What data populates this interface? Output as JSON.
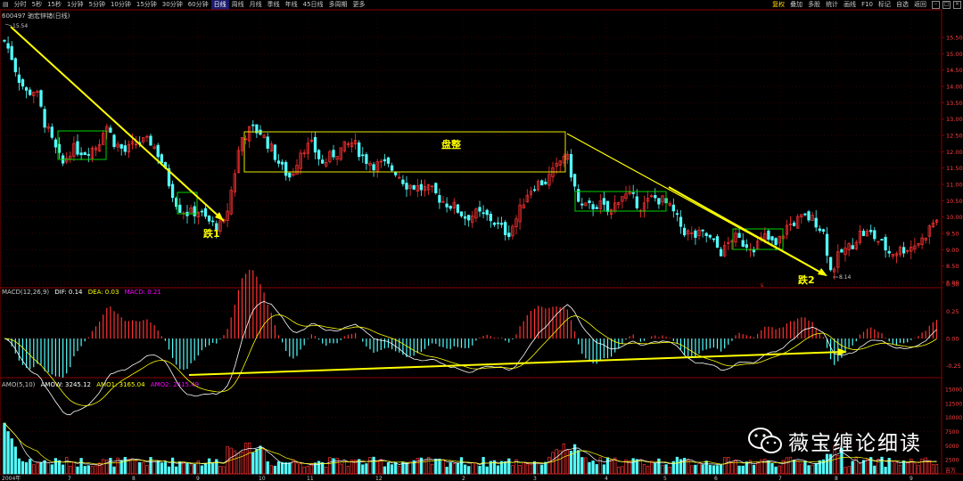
{
  "toolbar": {
    "items": [
      "分时",
      "5秒",
      "15秒",
      "1分钟",
      "5分钟",
      "10分钟",
      "15分钟",
      "30分钟",
      "60分钟",
      "日线",
      "周线",
      "月线",
      "季线",
      "年线",
      "45日线",
      "多周期",
      "更多"
    ],
    "active_index": 9,
    "right_items": [
      "复权",
      "叠加",
      "多股",
      "统计",
      "画线",
      "F10",
      "标记",
      "自选",
      "返回"
    ],
    "right_highlight_index": 0
  },
  "stock": {
    "title": "600497 驰宏锌锗(日线)"
  },
  "price_panel": {
    "high_label": "15.54",
    "low_label": "8.14",
    "ticks": [
      "15.50",
      "15.00",
      "14.50",
      "14.00",
      "13.50",
      "13.00",
      "12.50",
      "12.00",
      "11.50",
      "11.00",
      "10.50",
      "10.00",
      "9.50",
      "9.00",
      "8.50",
      "8.00"
    ],
    "annotation_fall1": "跌1",
    "annotation_fall2": "跌2",
    "annotation_box": "盘整",
    "marker_s": "s"
  },
  "macd_panel": {
    "name": "MACD(12,26,9)",
    "dif_label": "DIF: 0.14",
    "dea_label": "DEA: 0.03",
    "macd_label": "MACD: 0.21",
    "ticks": [
      "0.50",
      "0.25",
      "0.00",
      "-0.25"
    ]
  },
  "amo_panel": {
    "name": "AMO(5,10)",
    "amow_label": "AMOW: 3245.12",
    "amo1_label": "AMO1: 3165.04",
    "amo2_label": "AMO2: 2415.49",
    "ticks": [
      "15000",
      "12500",
      "10000",
      "7500",
      "5000",
      "2500",
      "百万"
    ]
  },
  "xaxis": {
    "labels": [
      "2004年",
      "7",
      "8",
      "9",
      "10",
      "11",
      "12",
      "2",
      "3",
      "4",
      "5",
      "6",
      "7",
      "8",
      "9"
    ]
  },
  "watermark": {
    "text": "薇宝缠论细读"
  },
  "colors": {
    "up": "#ff3232",
    "down": "#54fcfc",
    "annotation": "#ffff00",
    "box_green": "#00d000",
    "box_yellow": "#e8e800"
  }
}
